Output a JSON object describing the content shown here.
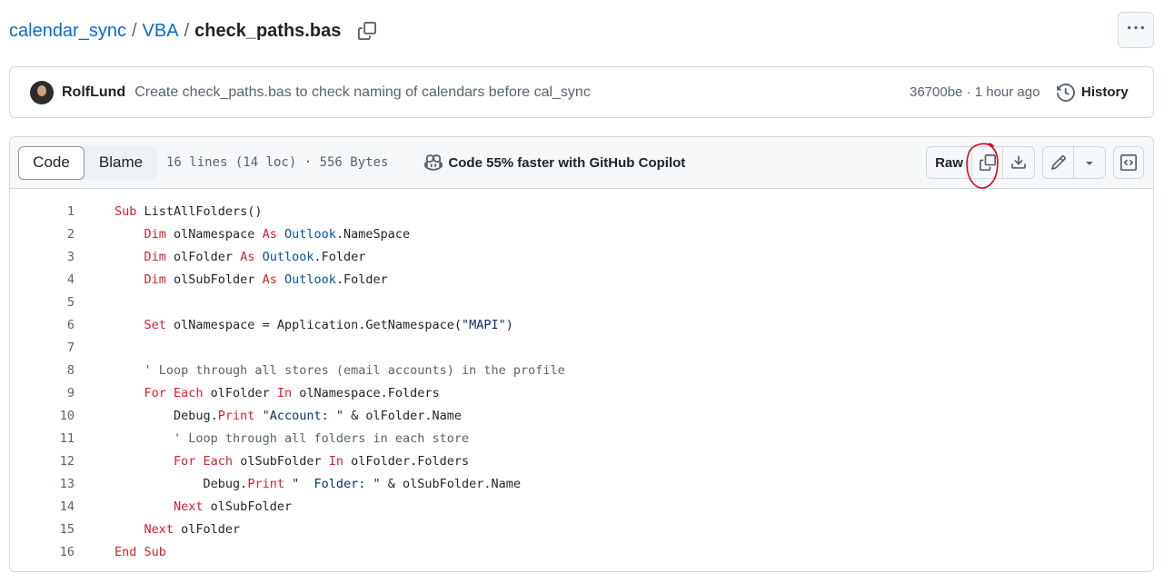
{
  "breadcrumb": {
    "repo": "calendar_sync",
    "folder": "VBA",
    "separator": "/",
    "file": "check_paths.bas"
  },
  "commit": {
    "author": "RolfLund",
    "message": "Create check_paths.bas to check naming of calendars before cal_sync",
    "sha_time": "36700be · 1 hour ago",
    "history_label": "History"
  },
  "toolbar": {
    "code_tab": "Code",
    "blame_tab": "Blame",
    "meta": "16 lines (14 loc) · 556 Bytes",
    "copilot": "Code 55% faster with GitHub Copilot",
    "raw_label": "Raw"
  },
  "icons": {
    "copy_path": "copy-icon",
    "more": "kebab-horizontal-icon",
    "history": "history-icon",
    "copilot": "copilot-icon",
    "copy_raw": "copy-icon",
    "download": "download-icon",
    "edit": "pencil-icon",
    "dropdown": "triangle-down-icon",
    "symbols": "code-square-icon"
  },
  "colors": {
    "link": "#0969da",
    "keyword": "#cf222e",
    "type": "#0550ae",
    "string": "#0a3069",
    "annotation": "#e0001b"
  },
  "code": {
    "language": "VBA",
    "lines": [
      [
        {
          "t": "kw",
          "v": "Sub"
        },
        {
          "t": "",
          "v": " ListAllFolders()"
        }
      ],
      [
        {
          "t": "",
          "v": "    "
        },
        {
          "t": "kw",
          "v": "Dim"
        },
        {
          "t": "",
          "v": " olNamespace "
        },
        {
          "t": "kw",
          "v": "As"
        },
        {
          "t": "",
          "v": " "
        },
        {
          "t": "ty",
          "v": "Outlook"
        },
        {
          "t": "",
          "v": ".NameSpace"
        }
      ],
      [
        {
          "t": "",
          "v": "    "
        },
        {
          "t": "kw",
          "v": "Dim"
        },
        {
          "t": "",
          "v": " olFolder "
        },
        {
          "t": "kw",
          "v": "As"
        },
        {
          "t": "",
          "v": " "
        },
        {
          "t": "ty",
          "v": "Outlook"
        },
        {
          "t": "",
          "v": ".Folder"
        }
      ],
      [
        {
          "t": "",
          "v": "    "
        },
        {
          "t": "kw",
          "v": "Dim"
        },
        {
          "t": "",
          "v": " olSubFolder "
        },
        {
          "t": "kw",
          "v": "As"
        },
        {
          "t": "",
          "v": " "
        },
        {
          "t": "ty",
          "v": "Outlook"
        },
        {
          "t": "",
          "v": ".Folder"
        }
      ],
      [],
      [
        {
          "t": "",
          "v": "    "
        },
        {
          "t": "kw",
          "v": "Set"
        },
        {
          "t": "",
          "v": " olNamespace = Application.GetNamespace("
        },
        {
          "t": "str",
          "v": "\"MAPI\""
        },
        {
          "t": "",
          "v": ")"
        }
      ],
      [],
      [
        {
          "t": "",
          "v": "    "
        },
        {
          "t": "cm",
          "v": "' Loop through all stores (email accounts) in the profile"
        }
      ],
      [
        {
          "t": "",
          "v": "    "
        },
        {
          "t": "kw",
          "v": "For Each"
        },
        {
          "t": "",
          "v": " olFolder "
        },
        {
          "t": "kw",
          "v": "In"
        },
        {
          "t": "",
          "v": " olNamespace.Folders"
        }
      ],
      [
        {
          "t": "",
          "v": "        Debug."
        },
        {
          "t": "kw",
          "v": "Print"
        },
        {
          "t": "",
          "v": " "
        },
        {
          "t": "str",
          "v": "\"Account: \""
        },
        {
          "t": "",
          "v": " & olFolder.Name"
        }
      ],
      [
        {
          "t": "",
          "v": "        "
        },
        {
          "t": "cm",
          "v": "' Loop through all folders in each store"
        }
      ],
      [
        {
          "t": "",
          "v": "        "
        },
        {
          "t": "kw",
          "v": "For Each"
        },
        {
          "t": "",
          "v": " olSubFolder "
        },
        {
          "t": "kw",
          "v": "In"
        },
        {
          "t": "",
          "v": " olFolder.Folders"
        }
      ],
      [
        {
          "t": "",
          "v": "            Debug."
        },
        {
          "t": "kw",
          "v": "Print"
        },
        {
          "t": "",
          "v": " "
        },
        {
          "t": "str",
          "v": "\"  Folder: \""
        },
        {
          "t": "",
          "v": " & olSubFolder.Name"
        }
      ],
      [
        {
          "t": "",
          "v": "        "
        },
        {
          "t": "kw",
          "v": "Next"
        },
        {
          "t": "",
          "v": " olSubFolder"
        }
      ],
      [
        {
          "t": "",
          "v": "    "
        },
        {
          "t": "kw",
          "v": "Next"
        },
        {
          "t": "",
          "v": " olFolder"
        }
      ],
      [
        {
          "t": "kw",
          "v": "End Sub"
        }
      ]
    ]
  }
}
